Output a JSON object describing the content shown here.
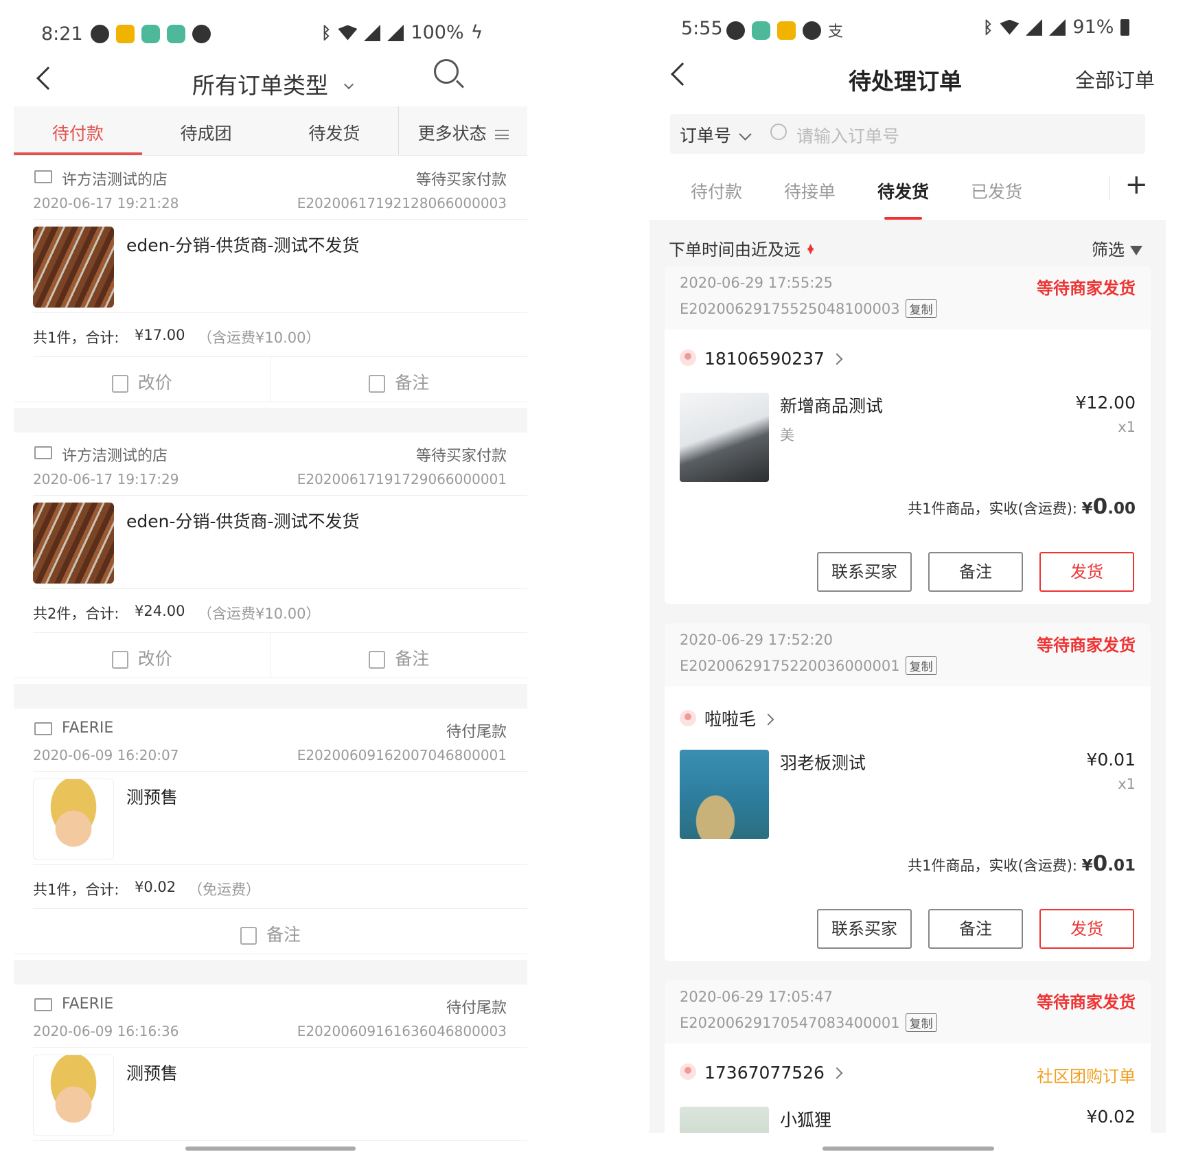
{
  "left": {
    "status_bar": {
      "time": "8:21",
      "battery": "100%"
    },
    "title": "所有订单类型",
    "tabs": [
      "待付款",
      "待成团",
      "待发货",
      "更多状态"
    ],
    "orders": [
      {
        "shop": "许方洁测试的店",
        "status": "等待买家付款",
        "date": "2020-06-17 19:21:28",
        "order_no": "E20200617192128066000003",
        "product": "eden-分销-供货商-测试不发货",
        "image": "bbq",
        "count_text": "共1件，合计:",
        "total": "¥17.00",
        "freight": "（含运费¥10.00）",
        "actions": [
          "改价",
          "备注"
        ]
      },
      {
        "shop": "许方洁测试的店",
        "status": "等待买家付款",
        "date": "2020-06-17 19:17:29",
        "order_no": "E20200617191729066000001",
        "product": "eden-分销-供货商-测试不发货",
        "image": "bbq",
        "count_text": "共2件，合计:",
        "total": "¥24.00",
        "freight": "（含运费¥10.00）",
        "actions": [
          "改价",
          "备注"
        ]
      },
      {
        "shop": "FAERIE",
        "status": "待付尾款",
        "date": "2020-06-09 16:20:07",
        "order_no": "E20200609162007046800001",
        "product": "测预售",
        "image": "luffy",
        "count_text": "共1件，合计:",
        "total": "¥0.02",
        "freight": "（免运费）",
        "actions": [
          "备注"
        ]
      },
      {
        "shop": "FAERIE",
        "status": "待付尾款",
        "date": "2020-06-09 16:16:36",
        "order_no": "E20200609161636046800003",
        "product": "测预售",
        "image": "luffy"
      }
    ]
  },
  "right": {
    "status_bar": {
      "time": "5:55",
      "battery": "91%"
    },
    "title": "待处理订单",
    "all_orders": "全部订单",
    "search": {
      "selector": "订单号",
      "placeholder": "请输入订单号"
    },
    "tabs": [
      "待付款",
      "待接单",
      "待发货",
      "已发货"
    ],
    "active_tab": "待发货",
    "sort": "下单时间由近及远",
    "filter": "筛选",
    "copy_label": "复制",
    "orders": [
      {
        "date": "2020-06-29 17:55:25",
        "order_no": "E20200629175525048100003",
        "status": "等待商家发货",
        "buyer": "18106590237",
        "product": "新增商品测试",
        "spec": "美",
        "price": "¥12.00",
        "qty": "x1",
        "sum_text": "共1件商品，实收(含运费):",
        "sum_symbol": "¥",
        "sum_int": "0",
        "sum_dec": ".00",
        "buttons": [
          "联系买家",
          "备注",
          "发货"
        ]
      },
      {
        "date": "2020-06-29 17:52:20",
        "order_no": "E20200629175220036000001",
        "status": "等待商家发货",
        "buyer": "啦啦毛",
        "product": "羽老板测试",
        "spec": "",
        "price": "¥0.01",
        "qty": "x1",
        "sum_text": "共1件商品，实收(含运费):",
        "sum_symbol": "¥",
        "sum_int": "0",
        "sum_dec": ".01",
        "buttons": [
          "联系买家",
          "备注",
          "发货"
        ]
      },
      {
        "date": "2020-06-29 17:05:47",
        "order_no": "E20200629170547083400001",
        "status": "等待商家发货",
        "buyer": "17367077526",
        "tag": "社区团购订单",
        "product": "小狐狸",
        "price": "¥0.02"
      }
    ]
  }
}
